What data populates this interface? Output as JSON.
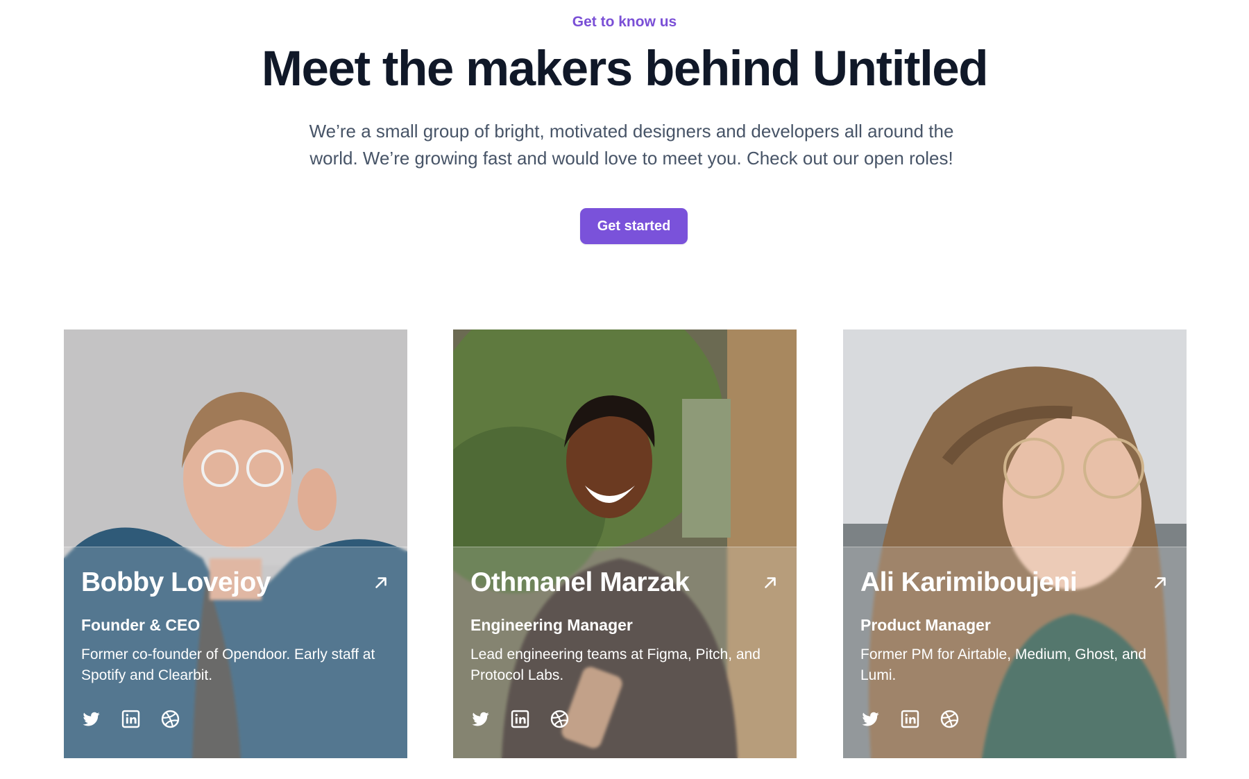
{
  "header": {
    "eyebrow": "Get to know us",
    "title": "Meet the makers behind Untitled",
    "subtitle": "We’re a small group of bright, motivated designers and developers all around the world. We’re growing fast and would love to meet you. Check out our open roles!",
    "cta_label": "Get started"
  },
  "colors": {
    "accent": "#7a52da",
    "heading": "#101828",
    "body": "#475467"
  },
  "team": [
    {
      "name": "Bobby Lovejoy",
      "role": "Founder & CEO",
      "bio": "Former co-founder of Opendoor. Early staff at Spotify and Clearbit.",
      "icons": [
        "twitter-icon",
        "linkedin-icon",
        "dribbble-icon"
      ]
    },
    {
      "name": "Othmanel Marzak",
      "role": "Engineering Manager",
      "bio": "Lead engineering teams at Figma, Pitch, and Protocol Labs.",
      "icons": [
        "twitter-icon",
        "linkedin-icon",
        "dribbble-icon"
      ]
    },
    {
      "name": "Ali Karimiboujeni",
      "role": "Product Manager",
      "bio": "Former PM for Airtable, Medium, Ghost, and Lumi.",
      "icons": [
        "twitter-icon",
        "linkedin-icon",
        "dribbble-icon"
      ]
    }
  ]
}
